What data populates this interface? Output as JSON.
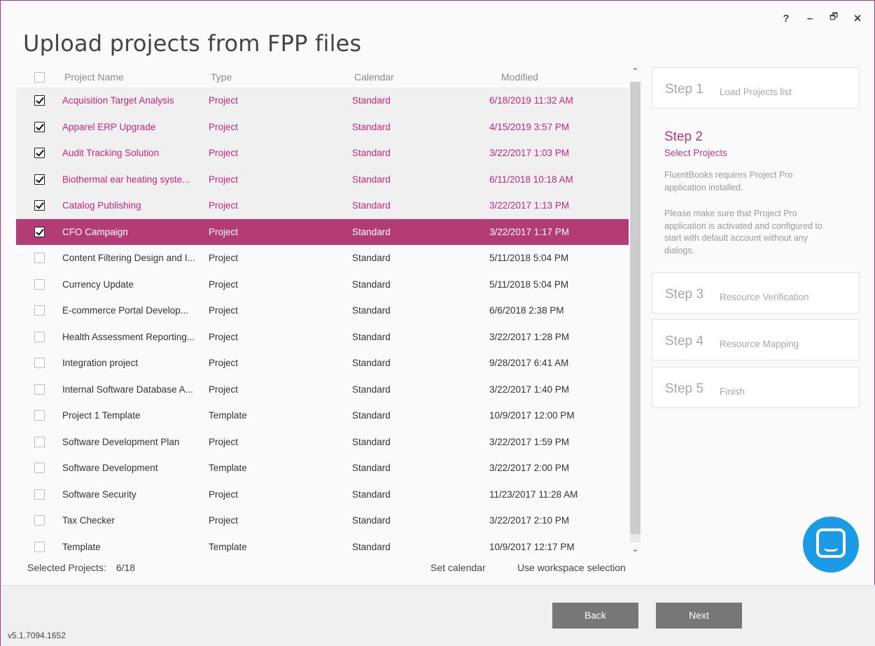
{
  "window": {
    "title": "Upload projects from FPP files",
    "controls": {
      "help": "?",
      "minimize": "–",
      "restore": "🗗",
      "close": "×"
    }
  },
  "table": {
    "columns": [
      "Project Name",
      "Type",
      "Calendar",
      "Modified"
    ],
    "rows": [
      {
        "name": "Acquisition Target Analysis",
        "type": "Project",
        "calendar": "Standard",
        "modified": "6/18/2019 11:32 AM",
        "checked": true
      },
      {
        "name": "Apparel ERP Upgrade",
        "type": "Project",
        "calendar": "Standard",
        "modified": "4/15/2019 3:57 PM",
        "checked": true
      },
      {
        "name": "Audit Tracking Solution",
        "type": "Project",
        "calendar": "Standard",
        "modified": "3/22/2017 1:03 PM",
        "checked": true
      },
      {
        "name": "Biothermal ear heating syste...",
        "type": "Project",
        "calendar": "Standard",
        "modified": "6/11/2018 10:18 AM",
        "checked": true
      },
      {
        "name": "Catalog Publishing",
        "type": "Project",
        "calendar": "Standard",
        "modified": "3/22/2017 1:13 PM",
        "checked": true
      },
      {
        "name": "CFO Campaign",
        "type": "Project",
        "calendar": "Standard",
        "modified": "3/22/2017 1:17 PM",
        "checked": true,
        "active": true
      },
      {
        "name": "Content Filtering Design and I...",
        "type": "Project",
        "calendar": "Standard",
        "modified": "5/11/2018 5:04 PM",
        "checked": false
      },
      {
        "name": "Currency Update",
        "type": "Project",
        "calendar": "Standard",
        "modified": "5/11/2018 5:04 PM",
        "checked": false
      },
      {
        "name": "E-commerce Portal Develop...",
        "type": "Project",
        "calendar": "Standard",
        "modified": "6/6/2018 2:38 PM",
        "checked": false
      },
      {
        "name": "Health Assessment Reporting...",
        "type": "Project",
        "calendar": "Standard",
        "modified": "3/22/2017 1:28 PM",
        "checked": false
      },
      {
        "name": "Integration project",
        "type": "Project",
        "calendar": "Standard",
        "modified": "9/28/2017 6:41 AM",
        "checked": false
      },
      {
        "name": "Internal Software Database A...",
        "type": "Project",
        "calendar": "Standard",
        "modified": "3/22/2017 1:40 PM",
        "checked": false
      },
      {
        "name": "Project 1 Template",
        "type": "Template",
        "calendar": "Standard",
        "modified": "10/9/2017 12:00 PM",
        "checked": false
      },
      {
        "name": "Software Development Plan",
        "type": "Project",
        "calendar": "Standard",
        "modified": "3/22/2017 1:59 PM",
        "checked": false
      },
      {
        "name": "Software Development",
        "type": "Template",
        "calendar": "Standard",
        "modified": "3/22/2017 2:00 PM",
        "checked": false
      },
      {
        "name": "Software Security",
        "type": "Project",
        "calendar": "Standard",
        "modified": "11/23/2017 11:28 AM",
        "checked": false
      },
      {
        "name": "Tax Checker",
        "type": "Project",
        "calendar": "Standard",
        "modified": "3/22/2017 2:10 PM",
        "checked": false
      },
      {
        "name": "Template",
        "type": "Template",
        "calendar": "Standard",
        "modified": "10/9/2017 12:17 PM",
        "checked": false
      }
    ]
  },
  "footer": {
    "selected_label": "Selected Projects:",
    "selected_count": "6/18",
    "set_calendar": "Set calendar",
    "use_workspace": "Use workspace selection"
  },
  "steps": {
    "step1": {
      "num": "Step 1",
      "label": "Load Projects list"
    },
    "step2": {
      "num": "Step 2",
      "label": "Select Projects",
      "desc1": "FluentBooks requires Project Pro application installed.",
      "desc2": "Please make sure that Project Pro application is activated and configured to start with default account without any dialogs."
    },
    "step3": {
      "num": "Step 3",
      "label": "Resource Verification"
    },
    "step4": {
      "num": "Step 4",
      "label": "Resource Mapping"
    },
    "step5": {
      "num": "Step 5",
      "label": "Finish"
    }
  },
  "buttons": {
    "back": "Back",
    "next": "Next"
  },
  "version": "v5.1.7094.1652",
  "colors": {
    "accent": "#b43c74",
    "checked_text": "#c0287a",
    "button": "#777777",
    "chat": "#1a9be6"
  },
  "icons": {
    "chat": "chat-bubble-icon",
    "scroll_up": "chevron-up-icon",
    "scroll_down": "chevron-down-icon"
  }
}
